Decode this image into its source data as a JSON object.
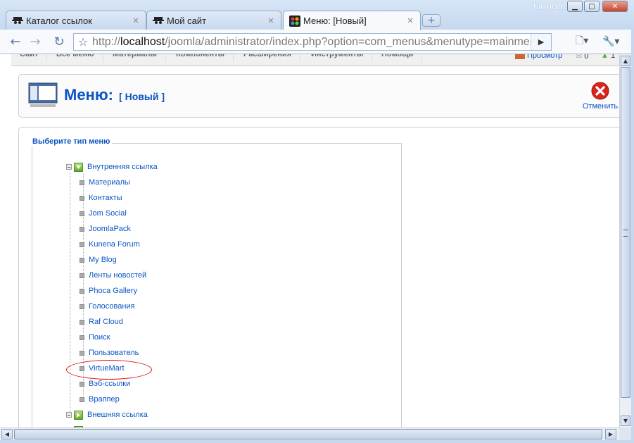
{
  "browser": {
    "brand": "Google",
    "tabs": [
      {
        "label": "Каталог ссылок",
        "icon": "spy-icon"
      },
      {
        "label": "Мой сайт",
        "icon": "spy-icon"
      },
      {
        "label": "Меню: [Новый]",
        "icon": "joomla-icon"
      }
    ],
    "address": {
      "scheme": "http://",
      "host": "localhost",
      "path": "/joomla/administrator/index.php?option=com_menus&menutype=mainmenu"
    }
  },
  "topmenu": {
    "items": [
      "Сайт",
      "Все меню",
      "Материалы",
      "Компоненты",
      "Расширения",
      "Инструменты",
      "Помощь"
    ],
    "preview": "Просмотр",
    "messages": "0",
    "users": "1"
  },
  "header": {
    "title": "Меню:",
    "subtitle": "[ Новый ]",
    "cancel": "Отменить"
  },
  "panel": {
    "legend": "Выберите тип меню",
    "internal_root": "Внутренняя ссылка",
    "items": [
      "Материалы",
      "Контакты",
      "Jom Social",
      "JoomlaPack",
      "Kunena Forum",
      "My Blog",
      "Ленты новостей",
      "Phoca Gallery",
      "Голосования",
      "Raf Cloud",
      "Поиск",
      "Пользователь",
      "VirtueMart",
      "Вэб-ссылки",
      "Враппер"
    ],
    "external_root": "Внешняя ссылка",
    "highlighted": "VirtueMart"
  },
  "colors": {
    "link": "#0b55c4",
    "highlight": "#dd1111"
  }
}
